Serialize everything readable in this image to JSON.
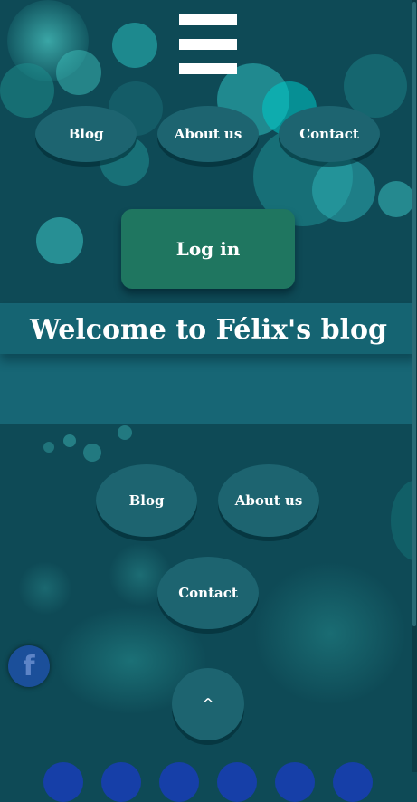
{
  "menu": {
    "icon": "hamburger-menu-icon",
    "top_nav": [
      "Blog",
      "About us",
      "Contact"
    ]
  },
  "login": {
    "label": "Log in"
  },
  "banner": {
    "title": "Welcome to Félix's blog"
  },
  "bottom_nav": {
    "blog": "Blog",
    "about": "About us",
    "contact": "Contact"
  },
  "social": {
    "facebook_icon": "facebook-icon",
    "facebook_glyph": "f"
  },
  "scroll_top": {
    "label": "^"
  },
  "colors": {
    "background": "#0e4a56",
    "pill": "#1d6470",
    "login": "#1f7660",
    "banner": "#1b7080",
    "facebook": "#1b4f9a"
  }
}
